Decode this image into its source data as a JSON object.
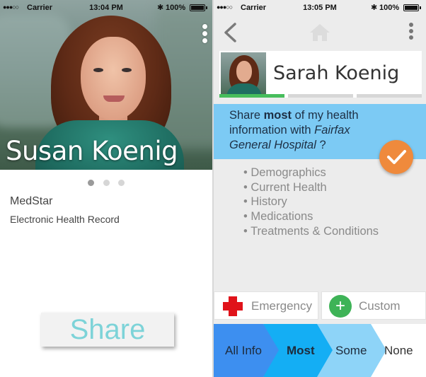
{
  "status_bar_left": {
    "signal": "●●●○○",
    "carrier": "Carrier",
    "time": "13:04 PM",
    "bluetooth": "✱",
    "battery": "100%"
  },
  "status_bar_right": {
    "signal": "●●●○○",
    "carrier": "Carrier",
    "time": "13:05 PM",
    "bluetooth": "✱",
    "battery": "100%"
  },
  "left_screen": {
    "person_name": "Susan Koenig",
    "page_indicator": {
      "pages": 3,
      "active_index": 0
    },
    "provider": "MedStar",
    "record_type": "Electronic Health Record",
    "share_button_label": "Share",
    "share_button_color": "#7dd3d8"
  },
  "right_screen": {
    "nav": {
      "back_icon": "chevron-left-icon",
      "home_icon": "home-icon",
      "more_icon": "more-vertical-icon"
    },
    "profile_name": "Sarah Koenig",
    "tab_strip": {
      "count": 3,
      "active_index": 0,
      "active_color": "#47bd5c"
    },
    "share_text": {
      "prefix": "Share ",
      "level": "most",
      "middle": " of my health information with ",
      "recipient": "Fairfax General Hospital",
      "suffix": " ?"
    },
    "banner_color": "#7ccaf4",
    "confirm_color": "#ef8a3c",
    "categories": [
      "Demographics",
      "Current Health",
      "History",
      "Medications",
      "Treatments & Conditions"
    ],
    "emergency_button": {
      "label": "Emergency",
      "icon": "red-cross-icon",
      "icon_color": "#e0131a"
    },
    "custom_button": {
      "label": "Custom",
      "icon": "plus-circle-icon",
      "icon_color": "#3eb357"
    },
    "levels": {
      "options": [
        "All Info",
        "Most",
        "Some",
        "None"
      ],
      "selected": "Most",
      "colors": [
        "#3d8ff0",
        "#14aef4",
        "#8ed4f8",
        "#ffffff"
      ]
    }
  }
}
